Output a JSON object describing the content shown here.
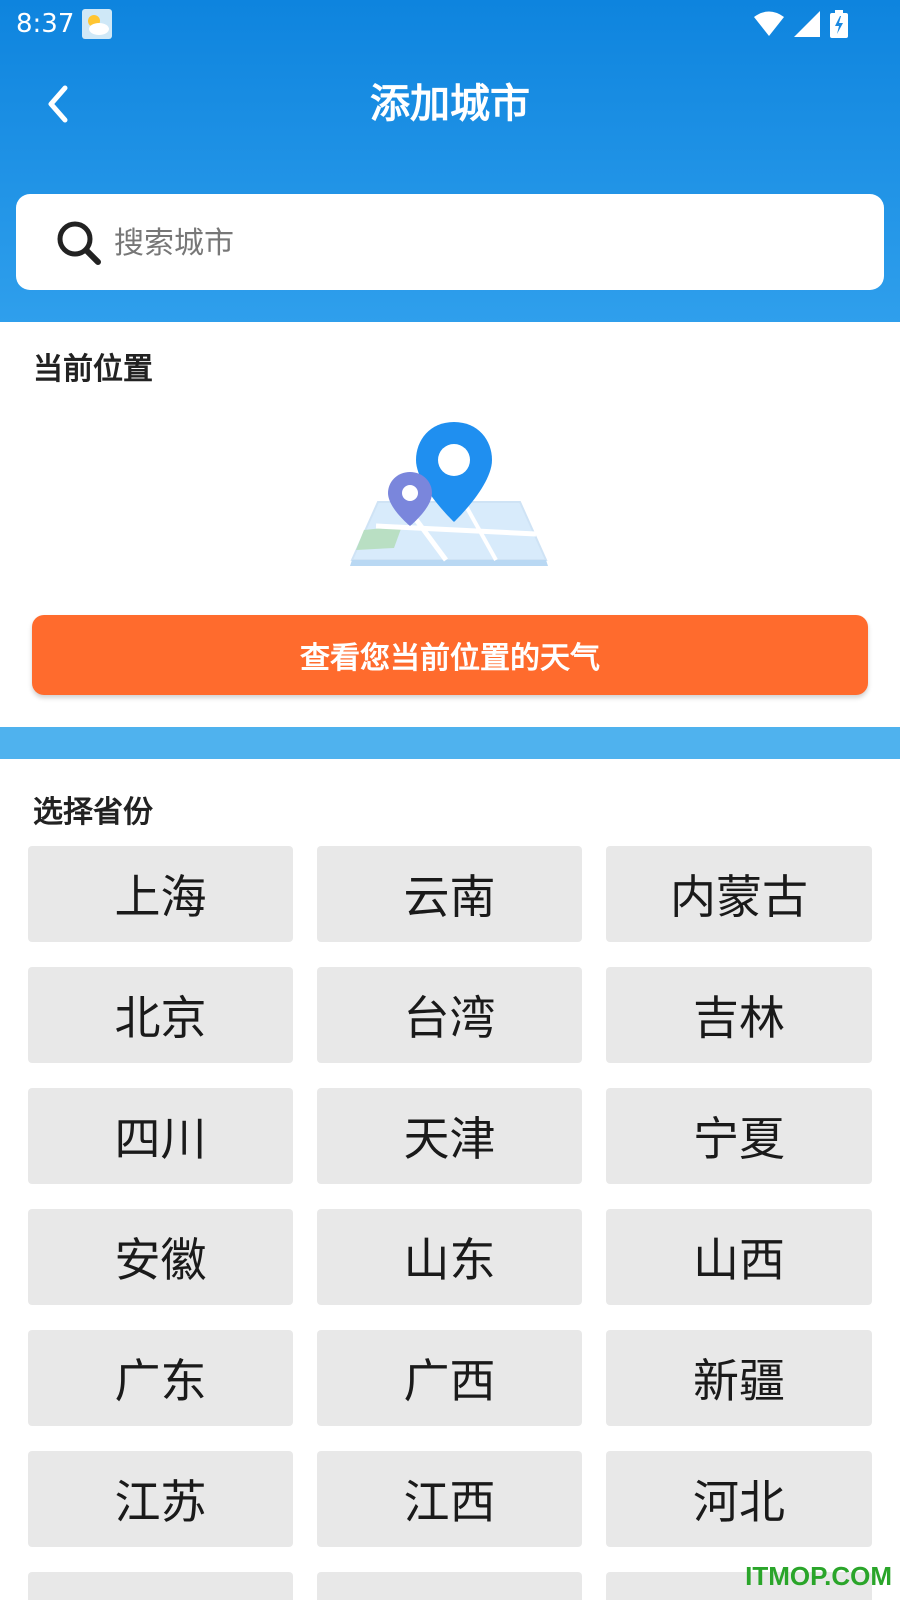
{
  "status_bar": {
    "time": "8:37",
    "icons": [
      "weather-icon",
      "wifi-icon",
      "signal-icon",
      "battery-charging-icon"
    ]
  },
  "header": {
    "title": "添加城市",
    "back_icon": "chevron-left-icon"
  },
  "search": {
    "placeholder": "搜索城市",
    "value": "",
    "icon": "search-icon"
  },
  "location_section": {
    "title": "当前位置",
    "illustration": "map-pin-icon",
    "button_label": "查看您当前位置的天气"
  },
  "province_section": {
    "title": "选择省份",
    "provinces": [
      "上海",
      "云南",
      "内蒙古",
      "北京",
      "台湾",
      "吉林",
      "四川",
      "天津",
      "宁夏",
      "安徽",
      "山东",
      "山西",
      "广东",
      "广西",
      "新疆",
      "江苏",
      "江西",
      "河北",
      "",
      "",
      ""
    ]
  },
  "watermark": "ITMOP.COM",
  "colors": {
    "header_top": "#0e84de",
    "header_bottom": "#2f9fec",
    "divider": "#4fb2ee",
    "accent_button": "#ff6b2d",
    "province_bg": "#e8e8e8",
    "watermark": "#2aa52a"
  }
}
